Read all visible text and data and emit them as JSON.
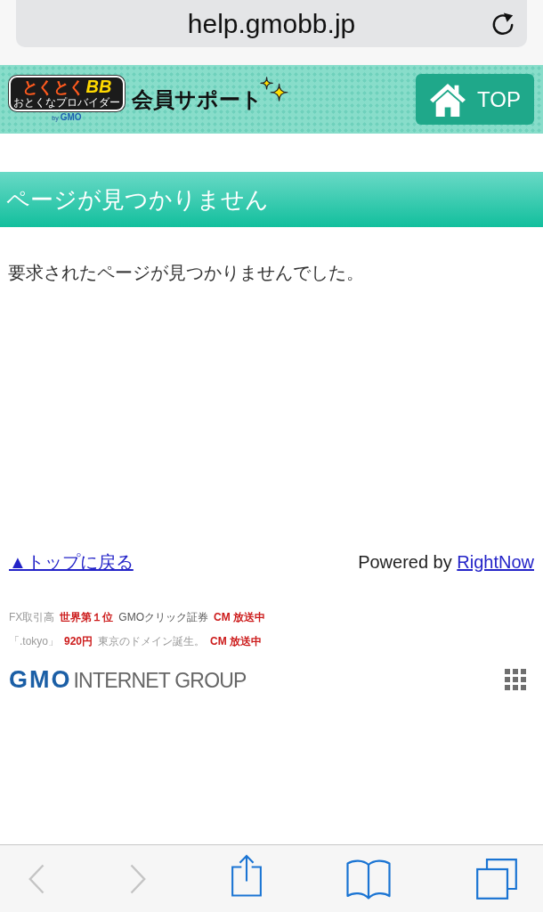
{
  "browser": {
    "url": "help.gmobb.jp"
  },
  "header": {
    "logo": {
      "wordmark": "とくとく",
      "wordmark_accent": "BB",
      "tagline": "おとくなプロバイダー",
      "byline_prefix": "by",
      "byline_brand": "GMO"
    },
    "title": "会員サポート",
    "top_button": "TOP"
  },
  "page": {
    "heading": "ページが見つかりません",
    "message": "要求されたページが見つかりませんでした。"
  },
  "footer": {
    "back_to_top": "▲トップに戻る",
    "powered_by": "Powered by",
    "powered_link": "RightNow"
  },
  "ads": [
    {
      "parts": [
        {
          "kind": "muted",
          "text": "FX取引高"
        },
        {
          "kind": "accent",
          "text": "世界第１位"
        },
        {
          "kind": "plain",
          "text": "GMOクリック証券"
        },
        {
          "kind": "accent",
          "text": "CM 放送中"
        }
      ]
    },
    {
      "parts": [
        {
          "kind": "muted",
          "text": "「.tokyo」"
        },
        {
          "kind": "accent",
          "text": "920円"
        },
        {
          "kind": "muted",
          "text": "東京のドメイン誕生。"
        },
        {
          "kind": "accent",
          "text": "CM 放送中"
        }
      ]
    }
  ],
  "group_logo": {
    "mark": "GMO",
    "name": "INTERNET GROUP"
  },
  "toolbar": {
    "buttons": [
      {
        "kind": "back",
        "disabled": true
      },
      {
        "kind": "forward",
        "disabled": true
      },
      {
        "kind": "share",
        "disabled": false
      },
      {
        "kind": "bookmarks",
        "disabled": false
      },
      {
        "kind": "tabs",
        "disabled": false
      }
    ]
  }
}
